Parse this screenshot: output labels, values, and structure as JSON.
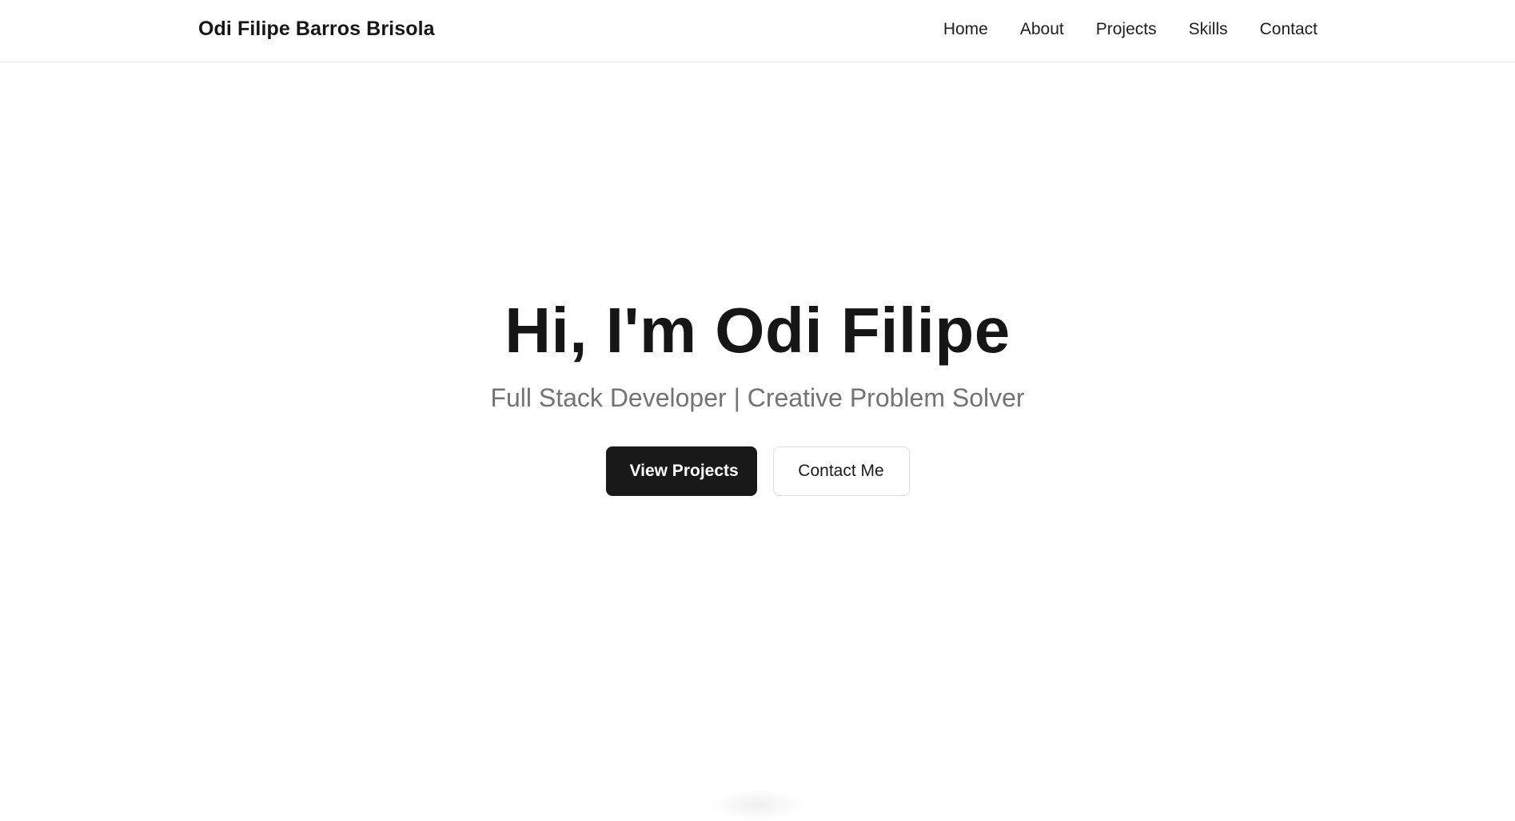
{
  "header": {
    "brand": "Odi Filipe Barros Brisola",
    "nav": [
      {
        "label": "Home"
      },
      {
        "label": "About"
      },
      {
        "label": "Projects"
      },
      {
        "label": "Skills"
      },
      {
        "label": "Contact"
      }
    ]
  },
  "hero": {
    "title": "Hi, I'm Odi Filipe",
    "subtitle": "Full Stack Developer | Creative Problem Solver",
    "primary_button": "View Projects",
    "secondary_button": "Contact Me"
  },
  "colors": {
    "text": "#161616",
    "muted": "#737373",
    "primary_button_bg": "#191919",
    "border": "#e6e6e6"
  }
}
